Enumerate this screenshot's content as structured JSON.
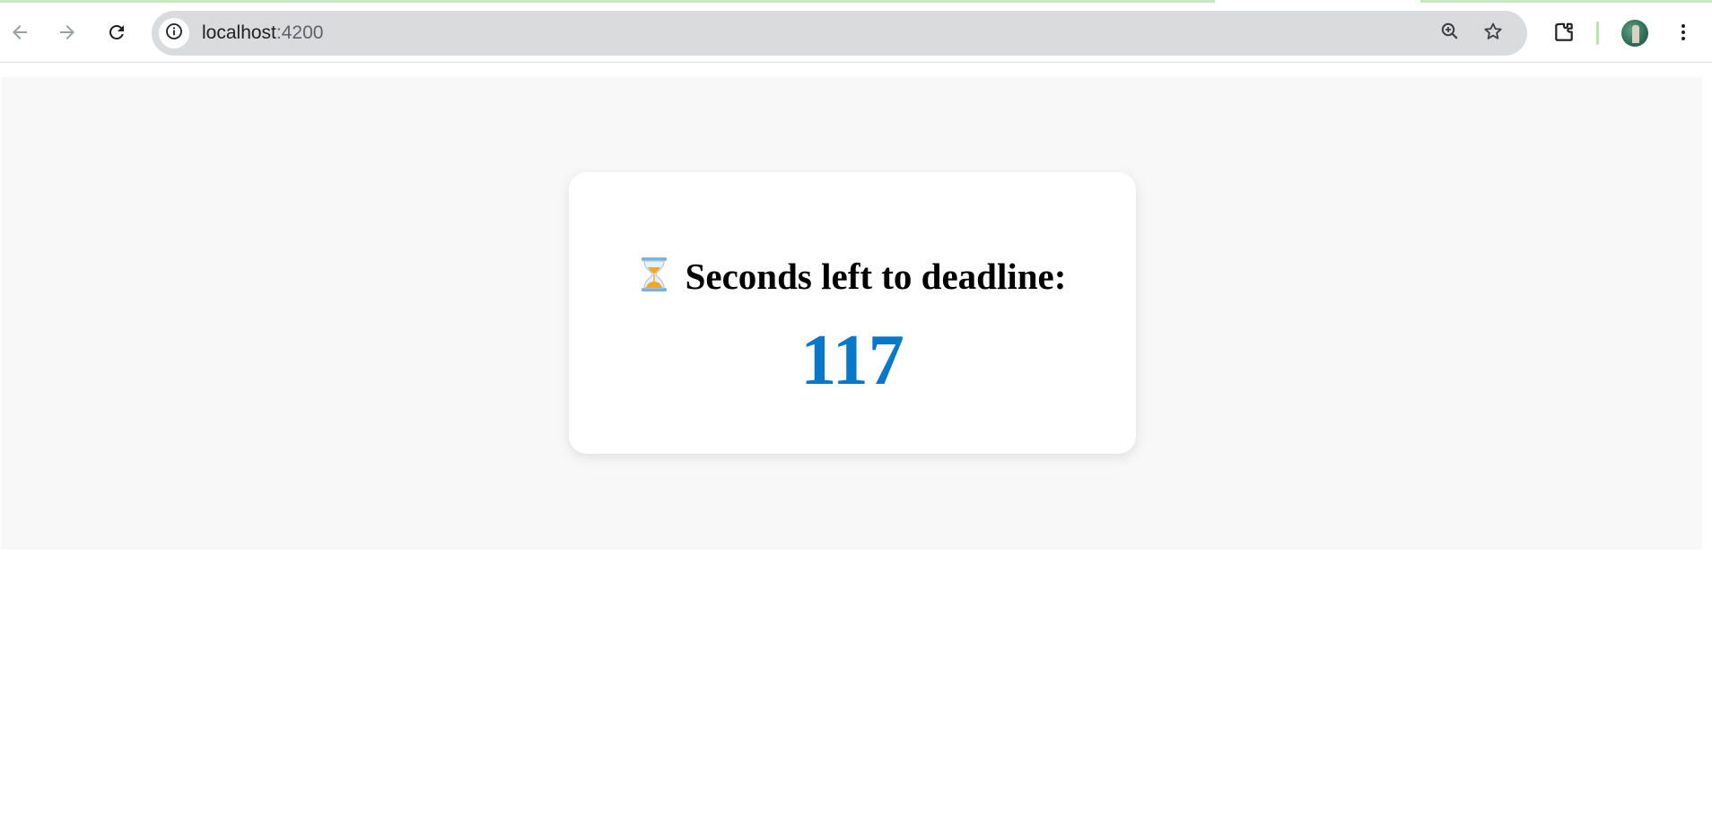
{
  "browser": {
    "url_host": "localhost",
    "url_port": ":4200",
    "icons": {
      "back": "back-arrow-icon",
      "forward": "forward-arrow-icon",
      "reload": "reload-icon",
      "site_info": "info-icon",
      "zoom": "zoom-in-icon",
      "bookmark": "star-icon",
      "extensions": "puzzle-icon",
      "menu": "kebab-menu-icon"
    }
  },
  "page": {
    "heading": "Seconds left to deadline:",
    "heading_icon": "hourglass-icon",
    "seconds_left": "117"
  },
  "colors": {
    "counter": "#0a78c8",
    "page_background": "#f8f8f8",
    "card_background": "#ffffff"
  }
}
